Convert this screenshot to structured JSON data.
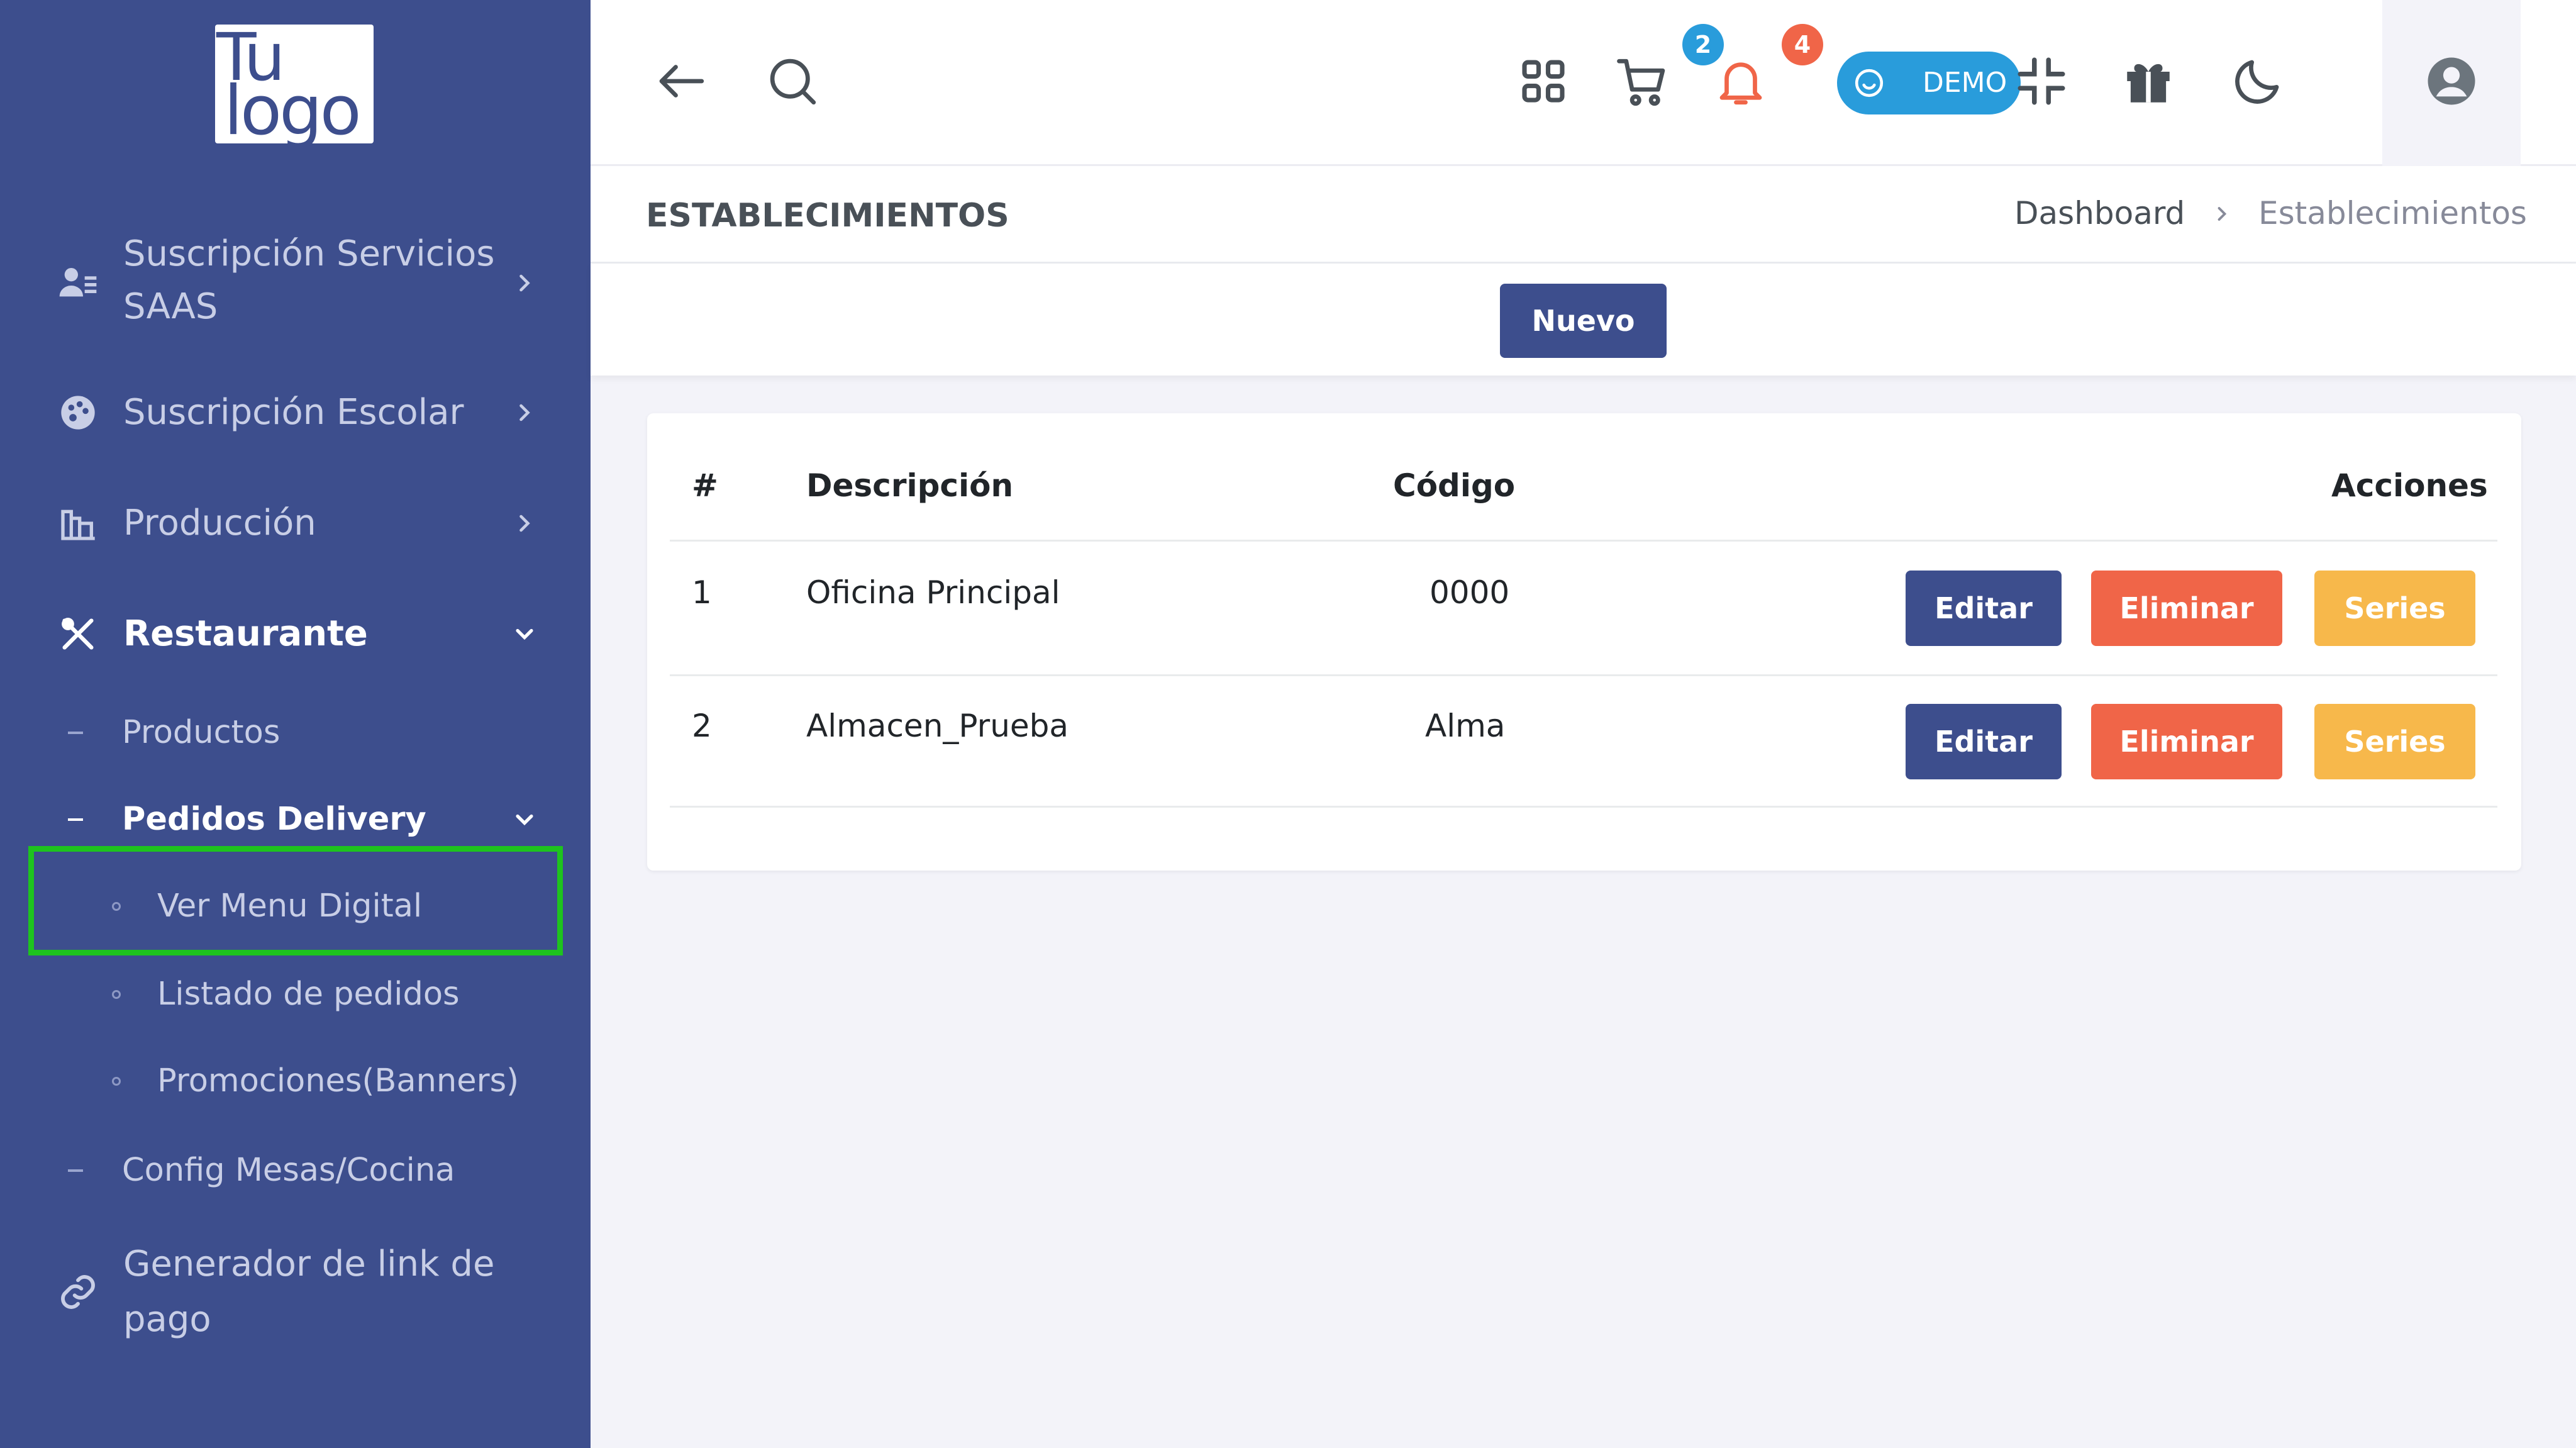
{
  "logo": {
    "line1": "Tu",
    "line2": "logo"
  },
  "sidebar": {
    "items": [
      {
        "label": "Suscripción Servicios",
        "label2": "SAAS",
        "icon": "user-list-icon"
      },
      {
        "label": "Suscripción Escolar",
        "icon": "palette-icon"
      },
      {
        "label": "Producción",
        "icon": "factory-icon"
      },
      {
        "label": "Restaurante",
        "icon": "utensils-icon"
      }
    ],
    "restaurante_sub": [
      {
        "label": "Productos"
      },
      {
        "label": "Pedidos Delivery"
      },
      {
        "label": "Config Mesas/Cocina"
      }
    ],
    "delivery_sub": [
      {
        "label": "Ver Menu Digital"
      },
      {
        "label": "Listado de pedidos"
      },
      {
        "label": "Promociones(Banners)"
      }
    ],
    "payment_link": {
      "label": "Generador de link de",
      "label2": "pago",
      "icon": "link-icon"
    }
  },
  "topbar": {
    "cart_count": "2",
    "notif_count": "4",
    "demo_label": "DEMO"
  },
  "page": {
    "title": "ESTABLECIMIENTOS",
    "breadcrumb": [
      "Dashboard",
      "Establecimientos"
    ],
    "new_button": "Nuevo"
  },
  "table": {
    "headers": [
      "#",
      "Descripción",
      "Código",
      "Acciones"
    ],
    "rows": [
      {
        "num": "1",
        "descripcion": "Oficina Principal",
        "codigo": "0000"
      },
      {
        "num": "2",
        "descripcion": "Almacen_Prueba",
        "codigo": "Alma"
      }
    ],
    "actions": {
      "edit": "Editar",
      "delete": "Eliminar",
      "series": "Series"
    }
  },
  "colors": {
    "sidebar_bg": "#3d4e8d",
    "primary": "#3d4e8d",
    "danger": "#f06548",
    "warning": "#f7b84b",
    "info": "#299cdb",
    "highlight": "#1ec31e"
  }
}
